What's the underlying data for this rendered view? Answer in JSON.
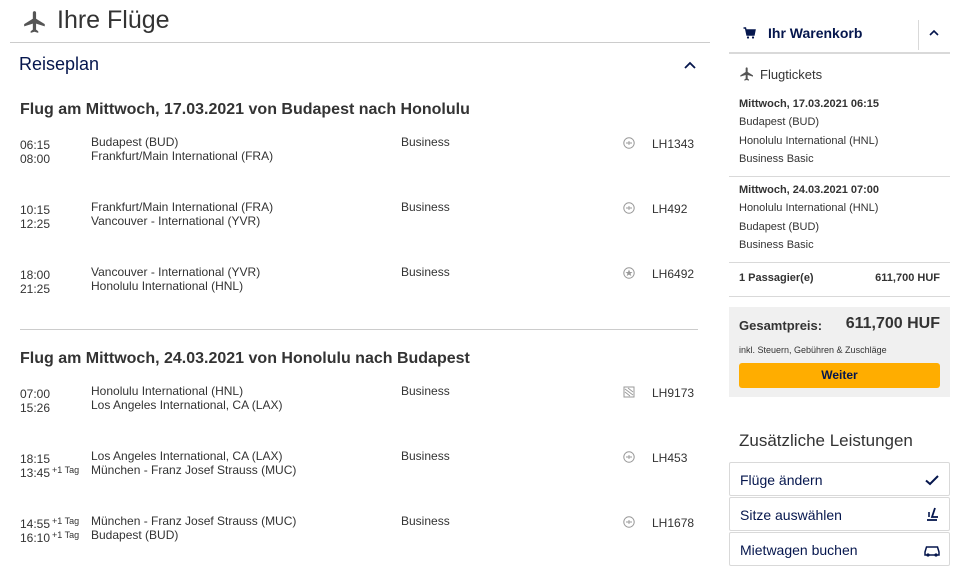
{
  "header": {
    "title": "Ihre Flüge",
    "icon": "airplane-icon"
  },
  "itinerary": {
    "section_label": "Reiseplan",
    "flights": [
      {
        "title": "Flug am Mittwoch, 17.03.2021 von Budapest nach Honolulu",
        "segments": [
          {
            "dep_time": "06:15",
            "dep_day": "",
            "arr_time": "08:00",
            "arr_day": "",
            "from": "Budapest (BUD)",
            "to": "Frankfurt/Main International (FRA)",
            "cabin": "Business",
            "airline_icon": "lufthansa-logo-icon",
            "flight_no": "LH1343"
          },
          {
            "dep_time": "10:15",
            "dep_day": "",
            "arr_time": "12:25",
            "arr_day": "",
            "from": "Frankfurt/Main International (FRA)",
            "to": "Vancouver - International (YVR)",
            "cabin": "Business",
            "airline_icon": "lufthansa-logo-icon",
            "flight_no": "LH492"
          },
          {
            "dep_time": "18:00",
            "dep_day": "",
            "arr_time": "21:25",
            "arr_day": "",
            "from": "Vancouver - International (YVR)",
            "to": "Honolulu International (HNL)",
            "cabin": "Business",
            "airline_icon": "air-canada-logo-icon",
            "flight_no": "LH6492"
          }
        ]
      },
      {
        "title": "Flug am Mittwoch, 24.03.2021 von Honolulu nach Budapest",
        "segments": [
          {
            "dep_time": "07:00",
            "dep_day": "",
            "arr_time": "15:26",
            "arr_day": "",
            "from": "Honolulu International (HNL)",
            "to": "Los Angeles International, CA (LAX)",
            "cabin": "Business",
            "airline_icon": "united-logo-icon",
            "flight_no": "LH9173"
          },
          {
            "dep_time": "18:15",
            "dep_day": "",
            "arr_time": "13:45",
            "arr_day": "+1 Tag",
            "from": "Los Angeles International, CA (LAX)",
            "to": "München - Franz Josef Strauss (MUC)",
            "cabin": "Business",
            "airline_icon": "lufthansa-logo-icon",
            "flight_no": "LH453"
          },
          {
            "dep_time": "14:55",
            "dep_day": "+1 Tag",
            "arr_time": "16:10",
            "arr_day": "+1 Tag",
            "from": "München - Franz Josef Strauss (MUC)",
            "to": "Budapest (BUD)",
            "cabin": "Business",
            "airline_icon": "lufthansa-logo-icon",
            "flight_no": "LH1678"
          }
        ]
      }
    ]
  },
  "cart": {
    "title": "Ihr Warenkorb",
    "tickets_label": "Flugtickets",
    "outbound": {
      "datetime": "Mittwoch, 17.03.2021 06:15",
      "from": "Budapest (BUD)",
      "to": "Honolulu International (HNL)",
      "fare": "Business Basic"
    },
    "inbound": {
      "datetime": "Mittwoch, 24.03.2021 07:00",
      "from": "Honolulu International (HNL)",
      "to": "Budapest (BUD)",
      "fare": "Business Basic"
    },
    "passengers": "1 Passagier(e)",
    "passenger_price": "611,700 HUF",
    "total_label": "Gesamtpreis:",
    "total_amount": "611,700 HUF",
    "total_note": "inkl. Steuern, Gebühren & Zuschläge",
    "continue_label": "Weiter"
  },
  "extras": {
    "title": "Zusätzliche Leistungen",
    "items": [
      {
        "label": "Flüge ändern",
        "icon": "checkmark-icon"
      },
      {
        "label": "Sitze auswählen",
        "icon": "seat-icon"
      },
      {
        "label": "Mietwagen buchen",
        "icon": "car-icon"
      }
    ]
  },
  "colors": {
    "accent": "#05164d",
    "button": "#ffad00",
    "summary_bg": "#f0f0f0"
  }
}
